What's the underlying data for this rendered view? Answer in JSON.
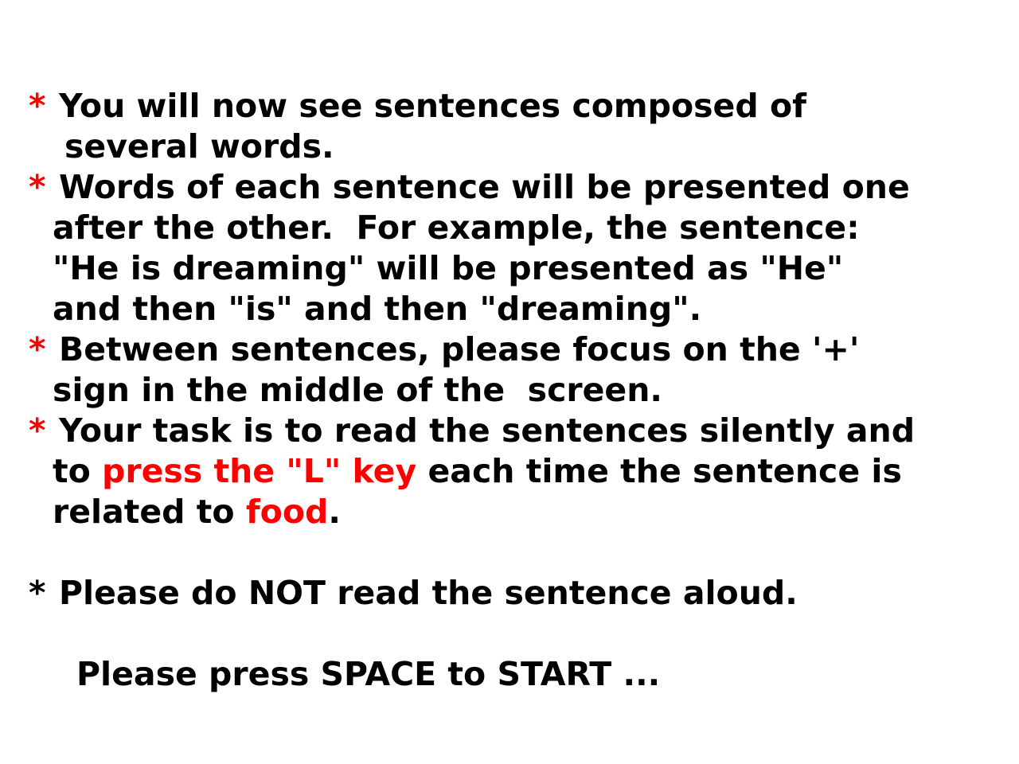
{
  "colors": {
    "background": "#ffffff",
    "text": "#000000",
    "highlight": "#ff0000"
  },
  "instructions": {
    "bullet": "*",
    "items": [
      {
        "line1": "You will now see sentences composed of",
        "line2": "several words."
      },
      {
        "line1": "Words of each sentence will be presented one",
        "line2": "after the other.  For example, the sentence:",
        "line3": "\"He is dreaming\" will be presented as \"He\"",
        "line4": "and then \"is\" and then \"dreaming\"."
      },
      {
        "line1": "Between sentences, please focus on the '+'",
        "line2": "sign in the middle of the  screen."
      },
      {
        "line1": "Your task is to read the sentences silently and",
        "line2_pre": "to ",
        "line2_key": "press the \"L\" key",
        "line2_post": " each time the sentence is",
        "line3_pre": "related to ",
        "line3_food": "food",
        "line3_post": "."
      },
      {
        "line1": "Please do NOT read the sentence aloud."
      }
    ]
  },
  "prompt": "Please press SPACE to START ..."
}
